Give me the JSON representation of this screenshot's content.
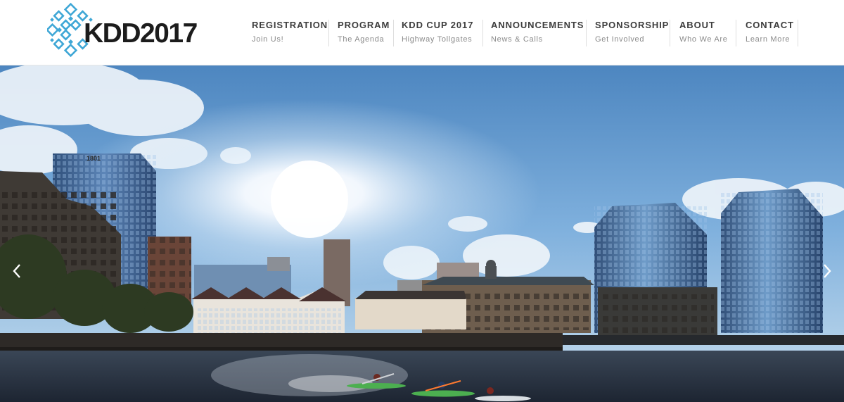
{
  "header": {
    "logo_text": "KDD2017",
    "nav": [
      {
        "title": "REGISTRATION",
        "subtitle": "Join Us!"
      },
      {
        "title": "PROGRAM",
        "subtitle": "The Agenda"
      },
      {
        "title": "KDD CUP 2017",
        "subtitle": "Highway Tollgates"
      },
      {
        "title": "ANNOUNCEMENTS",
        "subtitle": "News & Calls"
      },
      {
        "title": "SPONSORSHIP",
        "subtitle": "Get Involved"
      },
      {
        "title": "ABOUT",
        "subtitle": "Who We Are"
      },
      {
        "title": "CONTACT",
        "subtitle": "Learn More"
      }
    ]
  },
  "hero": {
    "building_sign": "1801",
    "icons": {
      "prev": "chevron-left-icon",
      "next": "chevron-right-icon"
    }
  },
  "colors": {
    "logo_snowflake": "#3fa7d6",
    "nav_title": "#3d3d3d",
    "nav_subtitle": "#8a8a8a",
    "sky": "#5f95c9",
    "water": "#263241"
  }
}
